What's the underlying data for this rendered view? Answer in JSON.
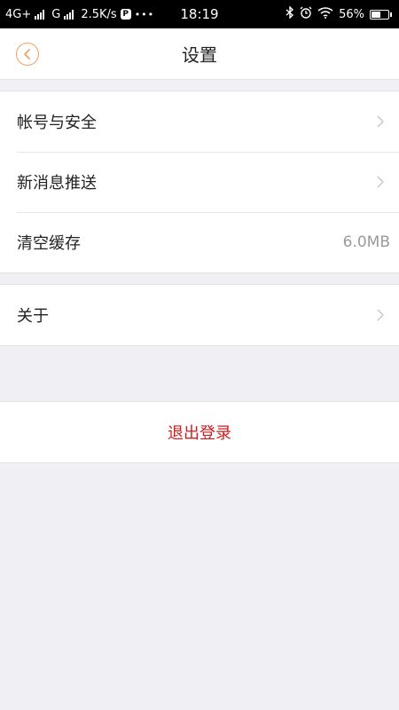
{
  "status_bar": {
    "network_1": "4G+",
    "network_2": "G",
    "speed": "2.5K/s",
    "more": "•••",
    "app_badge": "P",
    "time": "18:19",
    "battery": "56%",
    "battery_level": 0.56
  },
  "nav": {
    "title": "设置"
  },
  "settings": {
    "items": [
      {
        "label": "帐号与安全"
      },
      {
        "label": "新消息推送"
      },
      {
        "label": "清空缓存",
        "value": "6.0MB"
      }
    ],
    "about": {
      "label": "关于"
    },
    "logout": {
      "label": "退出登录"
    }
  },
  "colors": {
    "background": "#efeff4",
    "accent": "#f0a060",
    "logout": "#d01c1c"
  }
}
